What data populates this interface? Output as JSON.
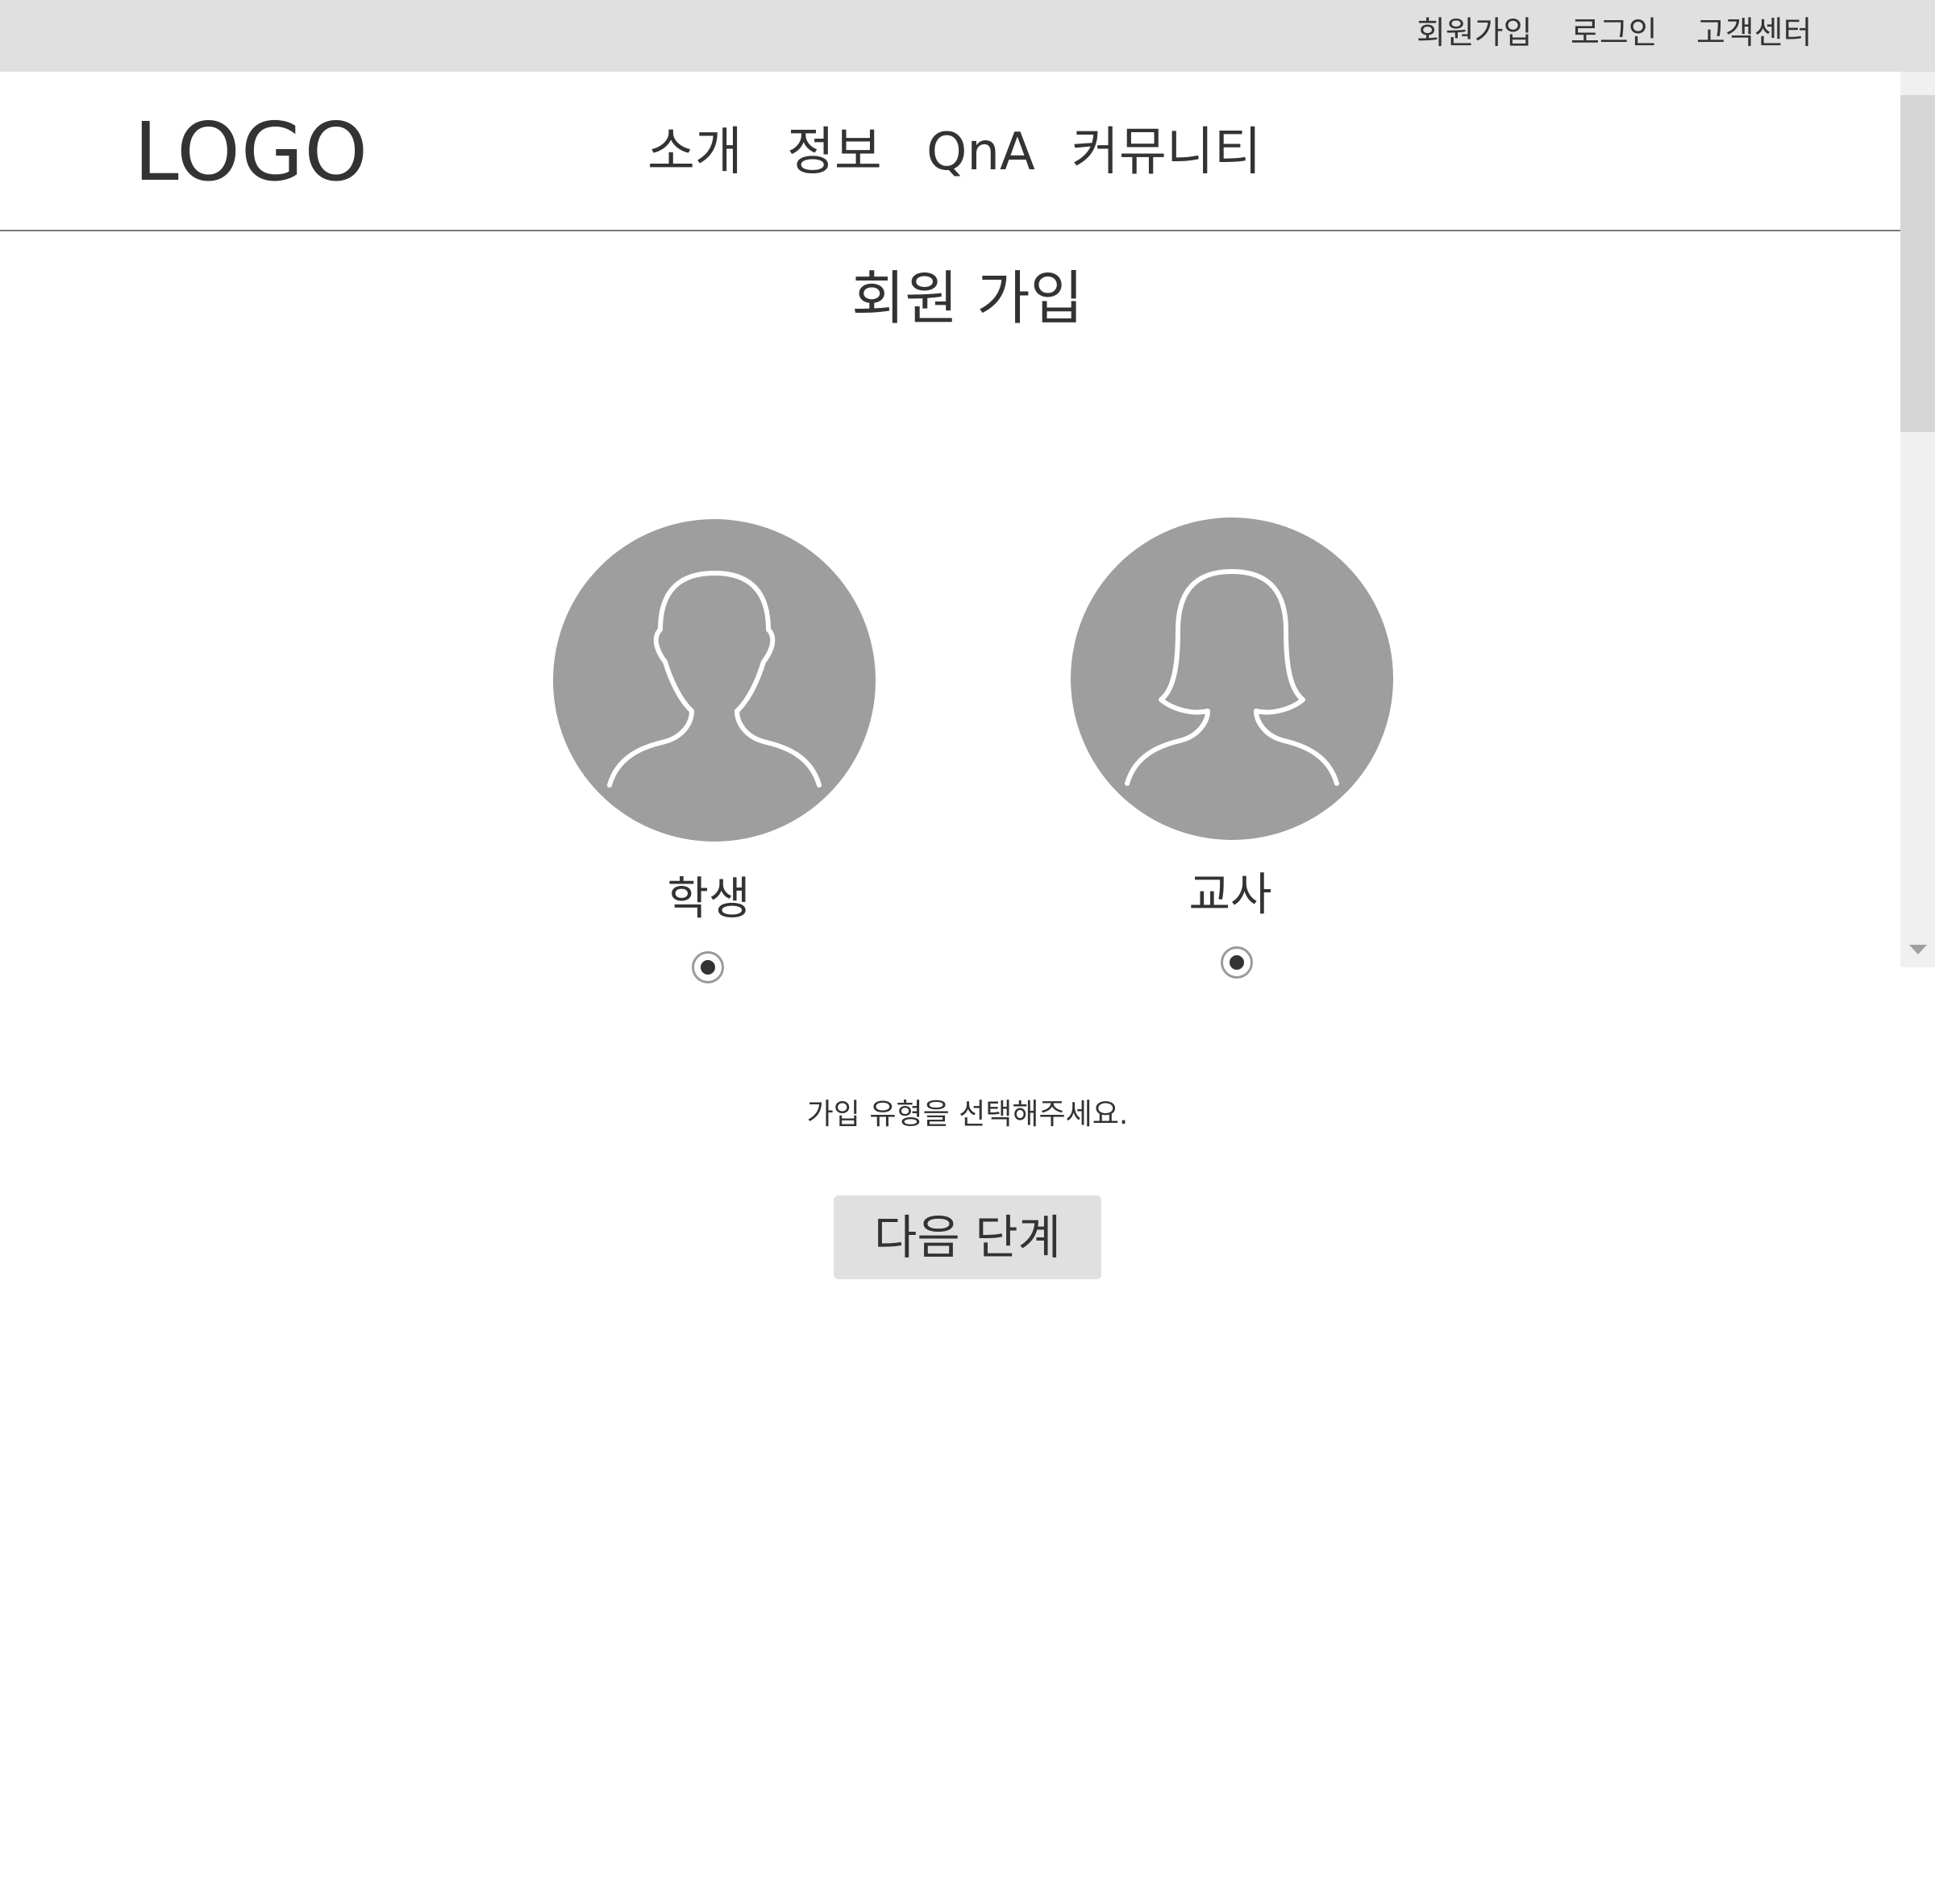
{
  "top_bar": {
    "links": [
      "회원가입",
      "로그인",
      "고객센터"
    ]
  },
  "header": {
    "logo": "LOGO",
    "nav": [
      "소개",
      "정보",
      "QnA",
      "커뮤니티"
    ]
  },
  "main": {
    "title": "회원 가입",
    "options": [
      {
        "label": "학생",
        "icon": "male-user-icon"
      },
      {
        "label": "교사",
        "icon": "female-user-icon"
      }
    ],
    "helper_text": "가입 유형을 선택해주세요.",
    "next_button": "다음 단계"
  },
  "colors": {
    "top_bar_bg": "#e0e0e0",
    "avatar_bg": "#9e9e9e",
    "text": "#333333",
    "button_bg": "#e0e0e0"
  }
}
